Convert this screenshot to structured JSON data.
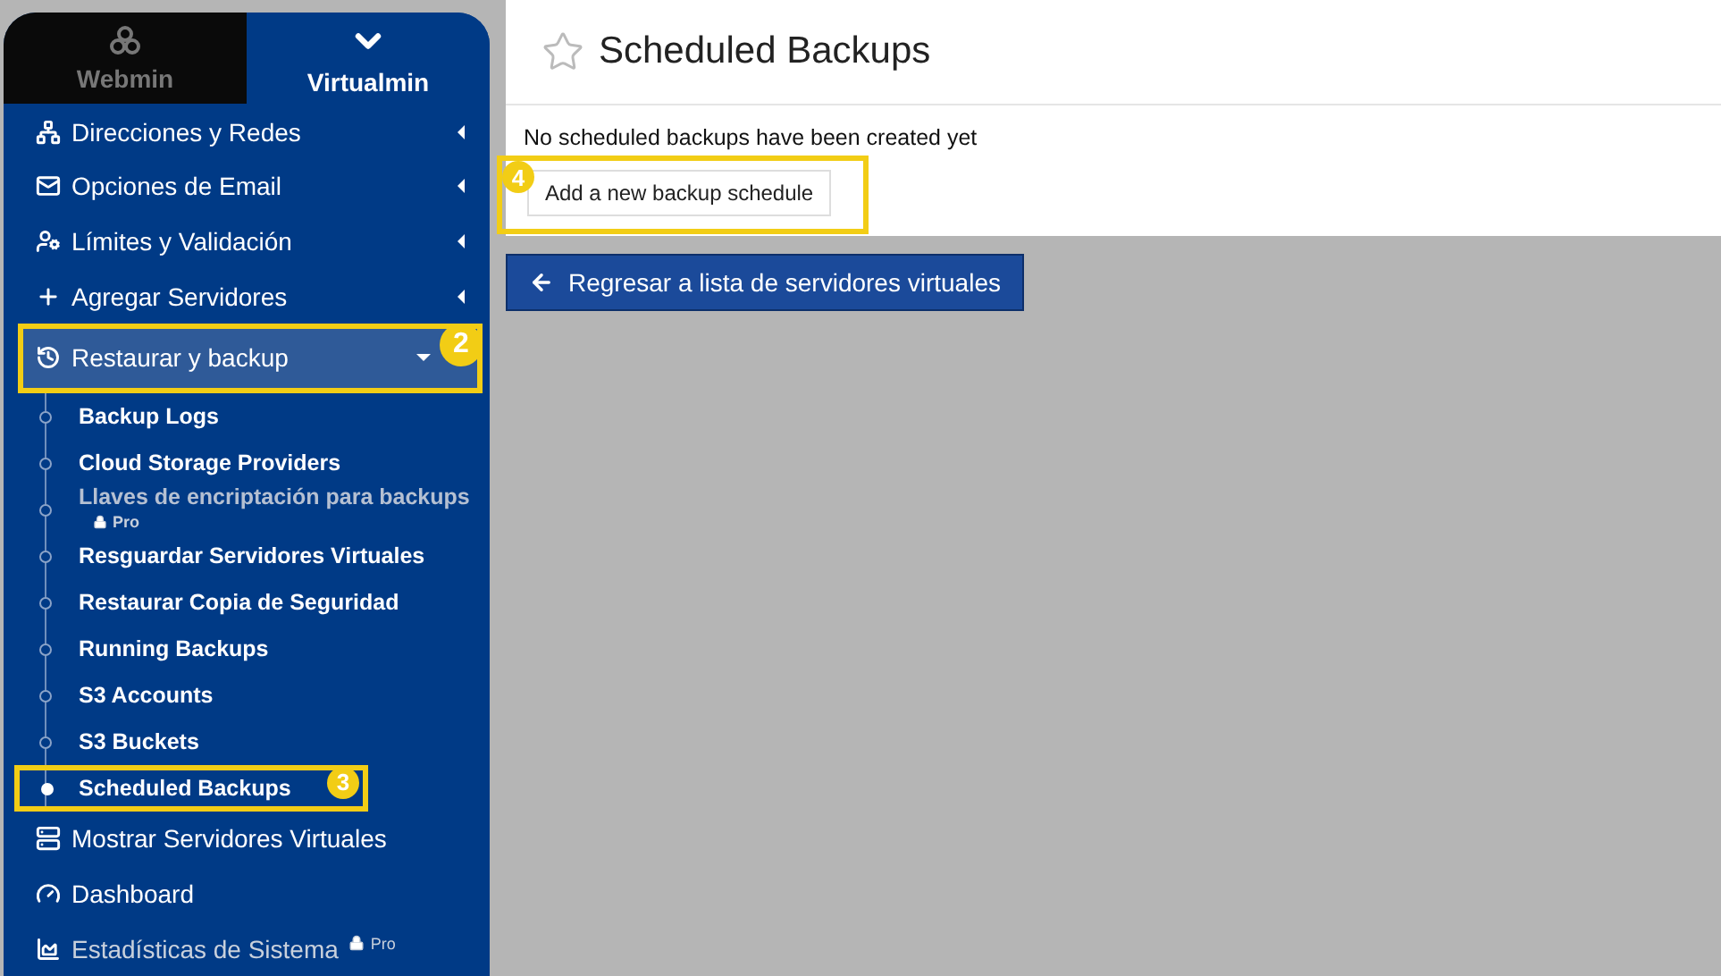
{
  "tabs": [
    {
      "label": "Webmin",
      "selected": false
    },
    {
      "label": "Virtualmin",
      "selected": true
    }
  ],
  "menu": [
    {
      "kind": "group",
      "label": "Direcciones y Redes",
      "expanded": false
    },
    {
      "kind": "group",
      "label": "Opciones de Email",
      "expanded": false
    },
    {
      "kind": "group",
      "label": "Límites y Validación",
      "expanded": false
    },
    {
      "kind": "group",
      "label": "Agregar Servidores",
      "expanded": false
    },
    {
      "kind": "group",
      "label": "Restaurar y backup",
      "expanded": true,
      "callout": "2",
      "children": [
        {
          "label": "Backup Logs",
          "selected": false,
          "disabled": false
        },
        {
          "label": "Cloud Storage Providers",
          "selected": false,
          "disabled": false
        },
        {
          "label": "Llaves de encriptación para backups",
          "selected": false,
          "disabled": true,
          "badge": "Pro"
        },
        {
          "label": "Resguardar Servidores Virtuales",
          "selected": false,
          "disabled": false
        },
        {
          "label": "Restaurar Copia de Seguridad",
          "selected": false,
          "disabled": false
        },
        {
          "label": "Running Backups",
          "selected": false,
          "disabled": false
        },
        {
          "label": "S3 Accounts",
          "selected": false,
          "disabled": false
        },
        {
          "label": "S3 Buckets",
          "selected": false,
          "disabled": false
        },
        {
          "label": "Scheduled Backups",
          "selected": true,
          "disabled": false,
          "callout": "3"
        }
      ]
    },
    {
      "kind": "link",
      "label": "Mostrar Servidores Virtuales"
    },
    {
      "kind": "link",
      "label": "Dashboard"
    },
    {
      "kind": "link",
      "label": "Estadísticas de Sistema",
      "disabled": true,
      "badge": "Pro"
    }
  ],
  "page": {
    "title": "Scheduled Backups",
    "message": "No scheduled backups have been created yet",
    "add_button": {
      "label": "Add a new backup schedule",
      "callout": "4"
    },
    "back_button": {
      "label": "Regresar a lista de servidores virtuales"
    }
  }
}
